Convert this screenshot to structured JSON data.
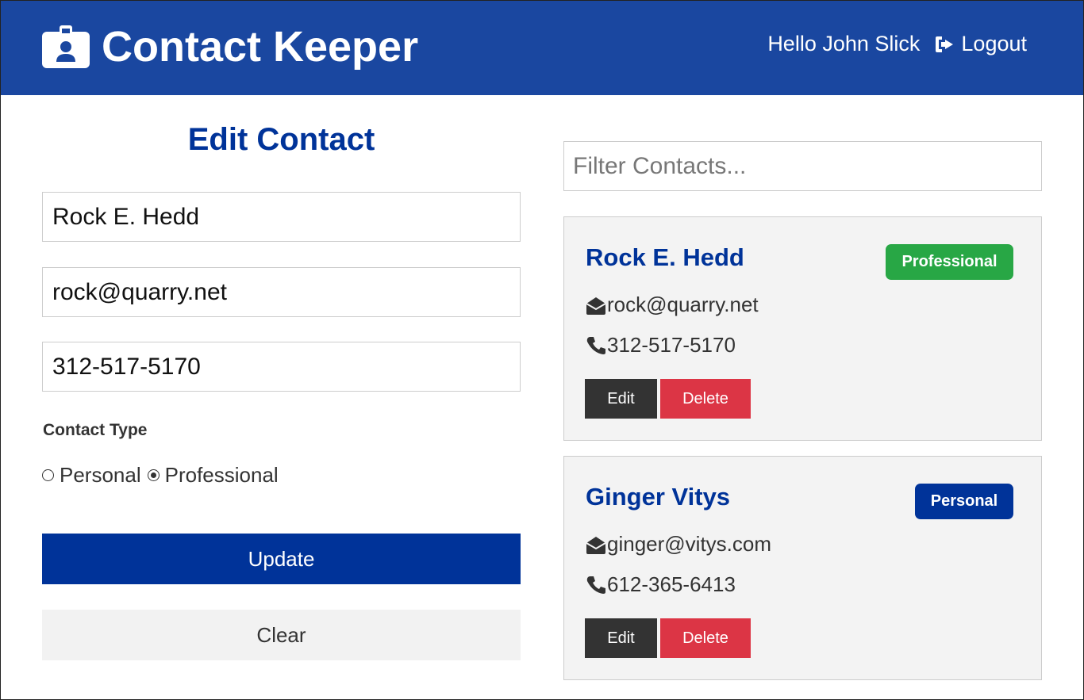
{
  "header": {
    "brand_title": "Contact Keeper",
    "greeting": "Hello John Slick",
    "logout_label": "Logout"
  },
  "form": {
    "title": "Edit Contact",
    "name_value": "Rock E. Hedd",
    "email_value": "rock@quarry.net",
    "phone_value": "312-517-5170",
    "type_label": "Contact Type",
    "type_options": [
      "Personal",
      "Professional"
    ],
    "selected_type": "Professional",
    "update_label": "Update",
    "clear_label": "Clear"
  },
  "filter": {
    "placeholder": "Filter Contacts..."
  },
  "contacts": [
    {
      "name": "Rock E. Hedd",
      "type": "Professional",
      "email": "rock@quarry.net",
      "phone": "312-517-5170",
      "edit_label": "Edit",
      "delete_label": "Delete"
    },
    {
      "name": "Ginger Vitys",
      "type": "Personal",
      "email": "ginger@vitys.com",
      "phone": "612-365-6413",
      "edit_label": "Edit",
      "delete_label": "Delete"
    }
  ],
  "colors": {
    "navbar": "#1a47a0",
    "primary": "#003399",
    "success": "#28a745",
    "danger": "#dc3545",
    "dark": "#333333",
    "light": "#f3f3f3"
  },
  "icons": {
    "brand": "id-badge-icon",
    "logout": "sign-out-icon",
    "email": "envelope-open-icon",
    "phone": "phone-icon"
  }
}
